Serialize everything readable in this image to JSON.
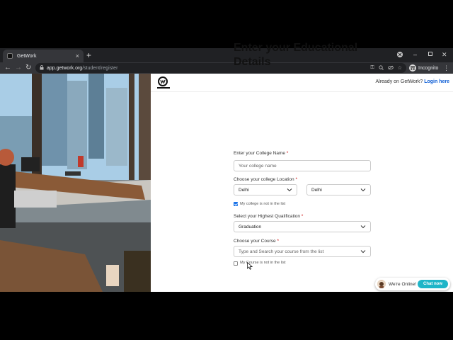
{
  "browser": {
    "tab_title": "GetWork",
    "tab_close": "×",
    "new_tab": "+",
    "url_host": "app.getwork.org",
    "url_path": "/student/register",
    "profile_label": "Incognito"
  },
  "header": {
    "already_text": "Already on GetWork?",
    "login_link": "Login here"
  },
  "form": {
    "heading_line1": "Enter your Educational",
    "heading_line2": "Details",
    "college_name_label": "Enter your College Name",
    "college_name_placeholder": "Your college name",
    "location_label": "Choose your college Location",
    "state_value": "Delhi",
    "city_value": "Delhi",
    "college_not_listed": "My college is not in the list",
    "qualification_label": "Select your Highest Qualification",
    "qualification_value": "Graduation",
    "course_label": "Choose your Course",
    "course_placeholder": "Type and Search your course from the list",
    "course_not_listed": "My Course is not in the list",
    "required_mark": "*"
  },
  "chat": {
    "status": "We're Online!",
    "button": "Chat now"
  },
  "colors": {
    "link": "#0b5cd5",
    "chat_button": "#1fb5c8",
    "checkbox": "#1a73e8"
  }
}
